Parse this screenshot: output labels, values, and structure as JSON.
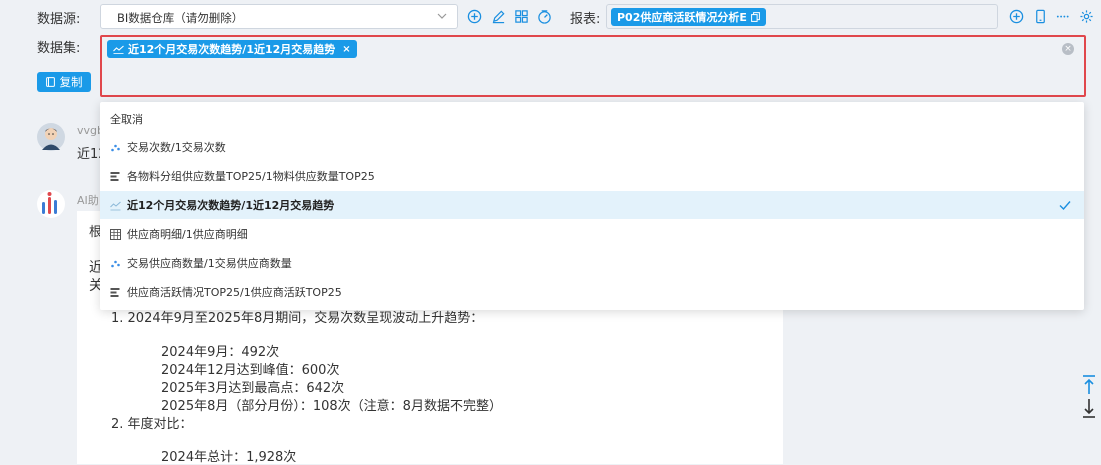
{
  "toolbar": {
    "datasource_label": "数据源:",
    "datasource_value": "BI数据仓库（请勿删除）",
    "report_label": "报表:",
    "report_tag": "P02供应商活跃情况分析E",
    "dataset_label": "数据集:",
    "dataset_tag": "近12个月交易次数趋势/1近12月交易趋势",
    "copy_label": "复制"
  },
  "chat": {
    "user_name": "vvgb",
    "user_msg_start": "近12",
    "ai_name": "AI助",
    "line_intro": "根",
    "line_head1": "近",
    "line_head2": "关",
    "point1": "1. 2024年9月至2025年8月期间，交易次数呈现波动上升趋势：",
    "p1_a": "2024年9月：492次",
    "p1_b": "2024年12月达到峰值：600次",
    "p1_c": "2025年3月达到最高点：642次",
    "p1_d": "2025年8月（部分月份）：108次（注意：8月数据不完整）",
    "point2": "2. 年度对比：",
    "p2_a": "2024年总计：1,928次"
  },
  "dropdown": {
    "items": [
      {
        "label": "全取消",
        "icon": "none"
      },
      {
        "label": "交易次数/1交易次数",
        "icon": "scatter-icon"
      },
      {
        "label": "各物料分组供应数量TOP25/1物料供应数量TOP25",
        "icon": "bar-icon"
      },
      {
        "label": "近12个月交易次数趋势/1近12月交易趋势",
        "icon": "line-icon",
        "selected": true
      },
      {
        "label": "供应商明细/1供应商明细",
        "icon": "table-icon"
      },
      {
        "label": "交易供应商数量/1交易供应商数量",
        "icon": "scatter-icon"
      },
      {
        "label": "供应商活跃情况TOP25/1供应商活跃TOP25",
        "icon": "bar-icon"
      }
    ]
  },
  "colors": {
    "accent": "#1a9ae8",
    "highlight_border": "#e0474c",
    "selected_row": "#e3f2fb"
  }
}
